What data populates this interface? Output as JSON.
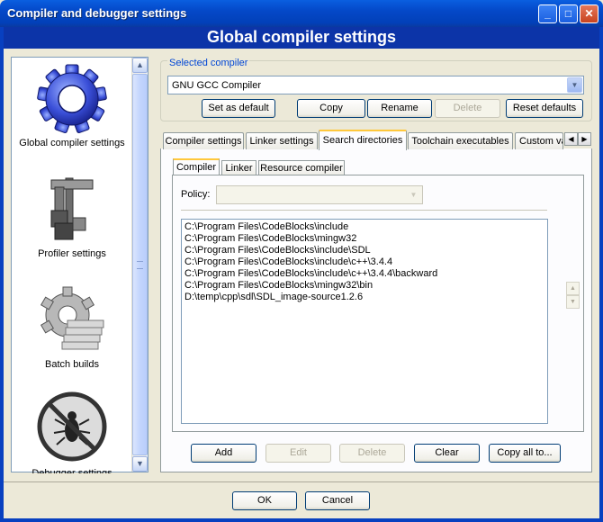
{
  "window": {
    "title": "Compiler and debugger settings",
    "minimize": "_",
    "maximize": "□",
    "close": "✕"
  },
  "header": {
    "title": "Global compiler settings"
  },
  "sidebar": {
    "items": [
      {
        "label": "Global compiler settings",
        "icon": "gear-icon"
      },
      {
        "label": "Profiler settings",
        "icon": "caliper-icon"
      },
      {
        "label": "Batch builds",
        "icon": "batch-gear-icon"
      },
      {
        "label": "Debugger settings",
        "icon": "no-bug-icon"
      }
    ],
    "scroll_up": "▲",
    "scroll_down": "▼"
  },
  "compiler_group": {
    "label": "Selected compiler",
    "selected": "GNU GCC Compiler",
    "dropdown_arrow": "▼",
    "buttons": {
      "set_default": "Set as default",
      "copy": "Copy",
      "rename": "Rename",
      "delete": "Delete",
      "reset": "Reset defaults"
    }
  },
  "tabs": [
    "Compiler settings",
    "Linker settings",
    "Search directories",
    "Toolchain executables",
    "Custom variables"
  ],
  "active_tab": "Search directories",
  "tab_scroll": {
    "left": "◀",
    "right": "▶"
  },
  "subtabs": [
    "Compiler",
    "Linker",
    "Resource compiler"
  ],
  "active_subtab": "Compiler",
  "policy": {
    "label": "Policy:",
    "value": "",
    "arrow": "▼"
  },
  "directories": [
    "C:\\Program Files\\CodeBlocks\\include",
    "C:\\Program Files\\CodeBlocks\\mingw32",
    "C:\\Program Files\\CodeBlocks\\include\\SDL",
    "C:\\Program Files\\CodeBlocks\\include\\c++\\3.4.4",
    "C:\\Program Files\\CodeBlocks\\include\\c++\\3.4.4\\backward",
    "C:\\Program Files\\CodeBlocks\\mingw32\\bin",
    "D:\\temp\\cpp\\sdl\\SDL_image-source1.2.6"
  ],
  "updown": {
    "up": "▲",
    "down": "▼"
  },
  "dir_buttons": {
    "add": "Add",
    "edit": "Edit",
    "delete": "Delete",
    "clear": "Clear",
    "copy_all": "Copy all to..."
  },
  "dialog_buttons": {
    "ok": "OK",
    "cancel": "Cancel"
  }
}
